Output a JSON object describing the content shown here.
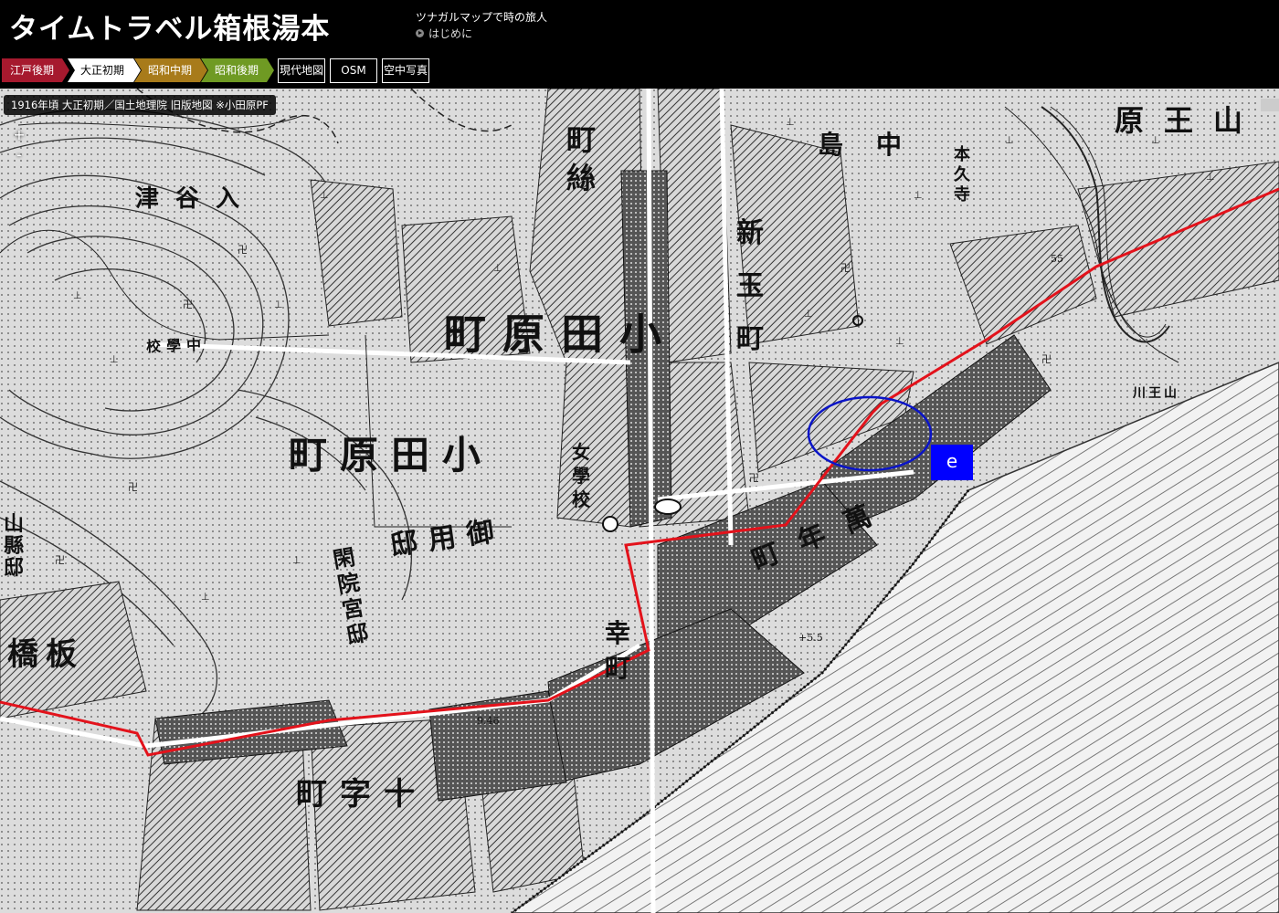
{
  "header": {
    "site_title": "タイムトラベル箱根湯本",
    "tagline": "ツナガルマップで時の旅人",
    "intro_link": "はじめに"
  },
  "era_tabs": [
    {
      "label": "江戸後期",
      "color": "#a6192e",
      "text_color": "#ffffff"
    },
    {
      "label": "大正初期",
      "color": "#ffffff",
      "text_color": "#000000"
    },
    {
      "label": "昭和中期",
      "color": "#a87b1a",
      "text_color": "#ffffff"
    },
    {
      "label": "昭和後期",
      "color": "#6f9a23",
      "text_color": "#ffffff"
    }
  ],
  "map_types": [
    "現代地図",
    "OSM",
    "空中写真"
  ],
  "map": {
    "caption": "1916年頃 大正初期／国土地理院 旧版地図 ※小田原PF",
    "zoom_in": "+",
    "zoom_out": "-",
    "route_color": "#e3121b",
    "highlight_color": "#0a14c8",
    "marker_label": "e",
    "marker_color": "#0000ff",
    "labels": {
      "odawara_town_top": "町原田小",
      "odawara_town_mid": "町原田小",
      "nakajima": "島中",
      "yamaou": "原王山",
      "ito_town": "町絲",
      "shin_tama": "新玉町",
      "manjo_town": "町年萬",
      "imperial_villa": "邸用御",
      "kanin_villa": "閑院宮邸",
      "itabashi": "橋板",
      "yamagata_villa": "山縣邸",
      "jujicho": "町字十",
      "saiwaicho": "幸町",
      "middle_school": "校學中",
      "girls_school": "女學校",
      "tsuyairi": "津谷入",
      "honkyuji": "本久寺",
      "river": "川王山",
      "elev_1": "9.46",
      "elev_2": "+5.5",
      "elev_3": "55"
    }
  }
}
